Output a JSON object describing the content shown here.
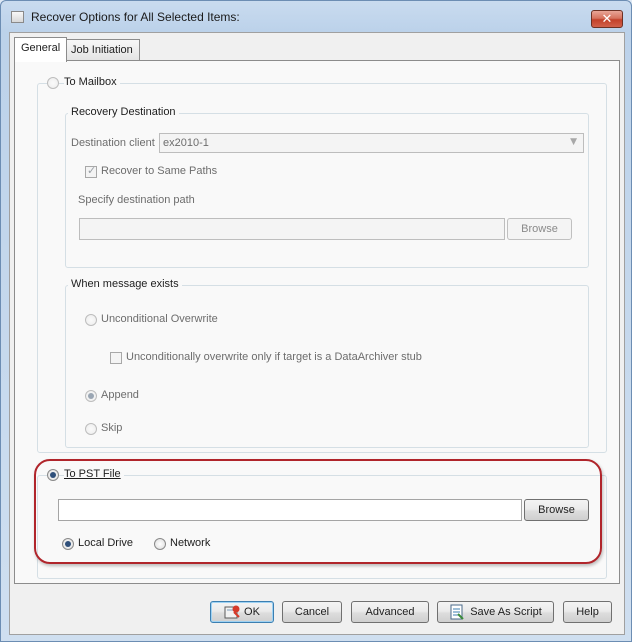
{
  "window": {
    "title": "Recover Options for All Selected Items:"
  },
  "tabs": [
    {
      "label": "General",
      "active": true
    },
    {
      "label": "Job Initiation",
      "active": false
    }
  ],
  "to_mailbox": {
    "label": "To Mailbox",
    "selected": false,
    "recovery_destination": {
      "title": "Recovery Destination",
      "destination_client_label": "Destination client",
      "destination_client_value": "ex2010-1",
      "recover_same_paths_label": "Recover to Same Paths",
      "recover_same_paths_checked": true,
      "specify_path_label": "Specify destination path",
      "path_value": "",
      "browse_label": "Browse"
    },
    "when_message_exists": {
      "title": "When message exists",
      "unconditional_overwrite_label": "Unconditional Overwrite",
      "overwrite_stub_label": "Unconditionally overwrite only if target is a DataArchiver stub",
      "overwrite_stub_checked": false,
      "append_label": "Append",
      "skip_label": "Skip",
      "selected": "Append"
    }
  },
  "to_pst": {
    "label": "To PST File",
    "selected": true,
    "path_value": "",
    "browse_label": "Browse",
    "local_drive_label": "Local Drive",
    "network_label": "Network",
    "location_selected": "Local Drive"
  },
  "buttons": {
    "ok": "OK",
    "cancel": "Cancel",
    "advanced": "Advanced",
    "save_as_script": "Save As Script",
    "help": "Help"
  },
  "colors": {
    "highlight_outline": "#b0252b",
    "title_bar": "#bcd2ea",
    "close_button": "#c2412a"
  }
}
